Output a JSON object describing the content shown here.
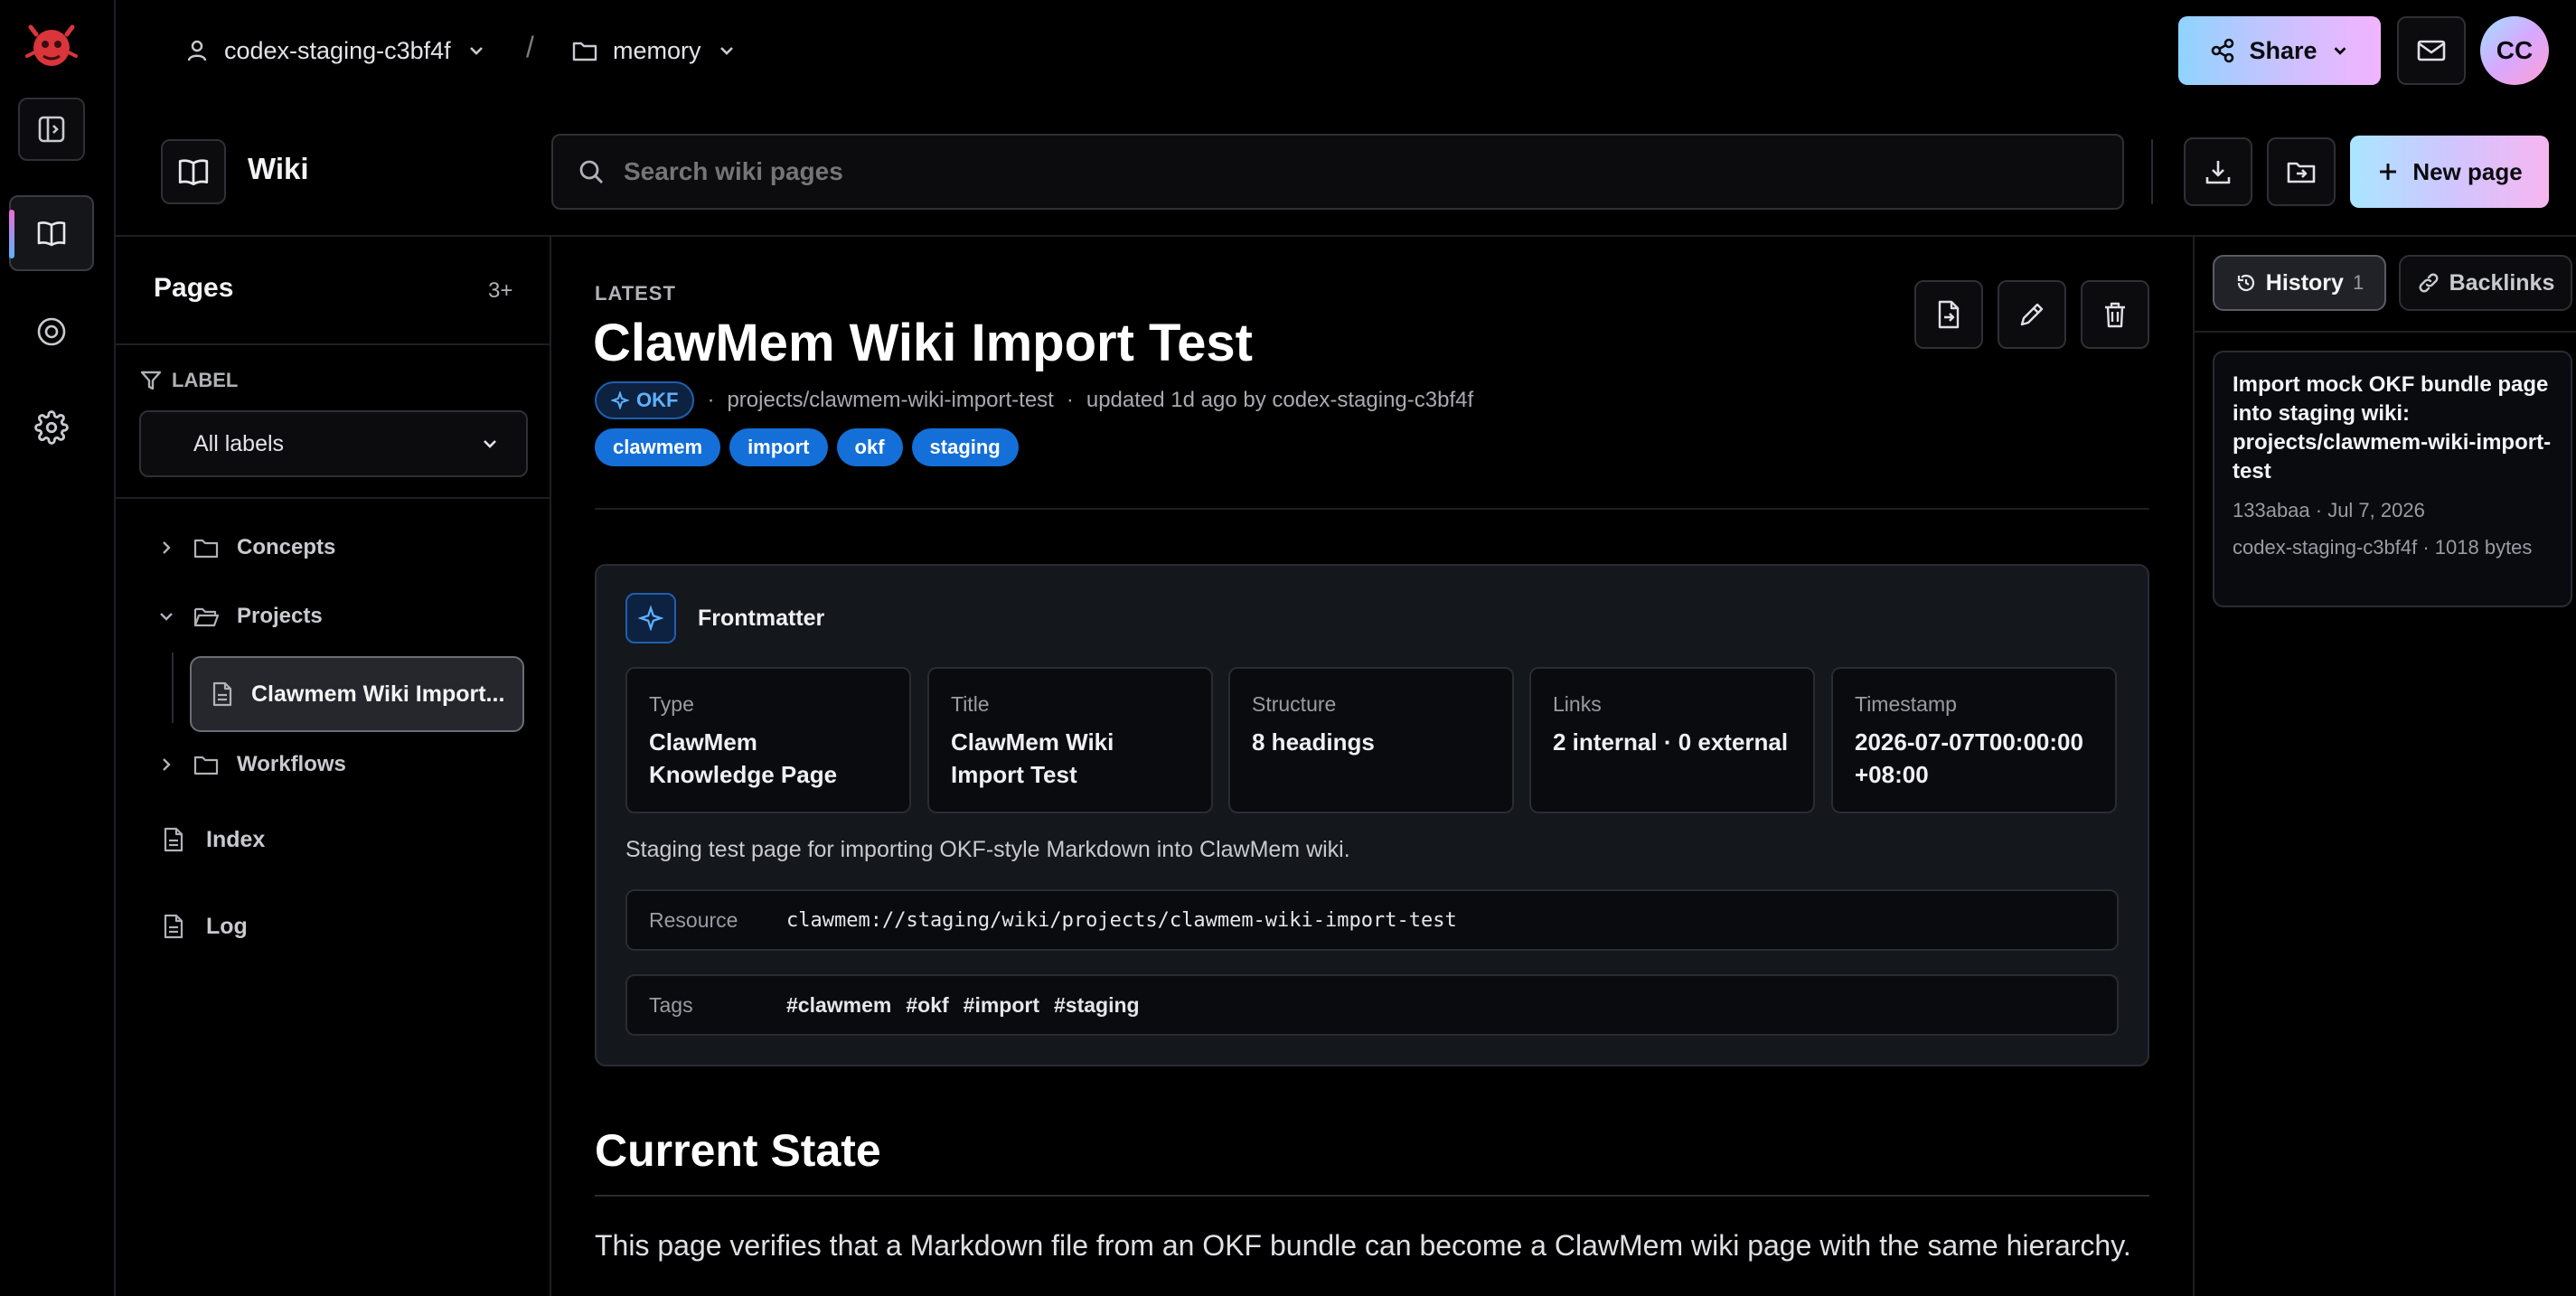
{
  "topbar": {
    "workspace": "codex-staging-c3bf4f",
    "separator": "/",
    "project": "memory",
    "share_label": "Share",
    "avatar_initials": "CC"
  },
  "header": {
    "section_title": "Wiki",
    "search_placeholder": "Search wiki pages",
    "new_page_label": "New page"
  },
  "sidebar": {
    "title": "Pages",
    "count": "3+",
    "label_filter_heading": "LABEL",
    "label_select_value": "All labels",
    "tree": [
      {
        "label": "Concepts",
        "expanded": false
      },
      {
        "label": "Projects",
        "expanded": true
      },
      {
        "label": "Clawmem Wiki Import...",
        "selected": true
      },
      {
        "label": "Workflows",
        "expanded": false
      },
      {
        "label": "Index"
      },
      {
        "label": "Log"
      }
    ]
  },
  "page": {
    "status": "LATEST",
    "title": "ClawMem Wiki Import Test",
    "badge": "OKF",
    "path": "projects/clawmem-wiki-import-test",
    "updated": "updated 1d ago by codex-staging-c3bf4f",
    "labels": [
      "clawmem",
      "import",
      "okf",
      "staging"
    ],
    "frontmatter": {
      "heading": "Frontmatter",
      "cards": [
        {
          "label": "Type",
          "value": "ClawMem Knowledge Page"
        },
        {
          "label": "Title",
          "value": "ClawMem Wiki Import Test"
        },
        {
          "label": "Structure",
          "value": "8 headings"
        },
        {
          "label": "Links",
          "value": "2 internal · 0 external"
        },
        {
          "label": "Timestamp",
          "value": "2026-07-07T00:00:00+08:00"
        }
      ],
      "description": "Staging test page for importing OKF-style Markdown into ClawMem wiki.",
      "resource_label": "Resource",
      "resource_value": "clawmem://staging/wiki/projects/clawmem-wiki-import-test",
      "tags_label": "Tags",
      "tags": [
        "#clawmem",
        "#okf",
        "#import",
        "#staging"
      ]
    },
    "section_heading": "Current State",
    "body_text": "This page verifies that a Markdown file from an OKF bundle can become a ClawMem wiki page with the same hierarchy."
  },
  "right_panel": {
    "history_label": "History",
    "history_count": "1",
    "backlinks_label": "Backlinks",
    "commit": {
      "title": "Import mock OKF bundle page into staging wiki: projects/clawmem-wiki-import-test",
      "hash_date": "133abaa · Jul 7, 2026",
      "author_size": "codex-staging-c3bf4f · 1018 bytes"
    }
  },
  "colors": {
    "background": "#000000",
    "accent_blue": "#1470d8",
    "border": "#2a2c33",
    "share_gradient_start": "#8fd3ff",
    "share_gradient_end": "#f3b3ff"
  }
}
